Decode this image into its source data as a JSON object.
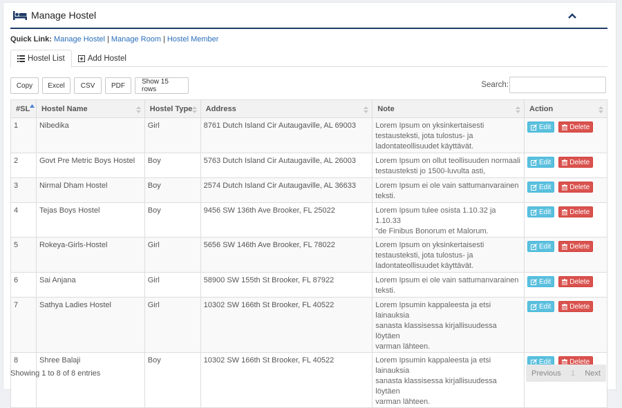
{
  "header": {
    "title": "Manage Hostel"
  },
  "quick_links": {
    "label": "Quick Link:",
    "items": [
      "Manage Hostel",
      "Manage Room",
      "Hostel Member"
    ]
  },
  "tabs": [
    {
      "label": "Hostel List",
      "icon": "list-icon",
      "active": true
    },
    {
      "label": "Add Hostel",
      "icon": "plus-square-icon",
      "active": false
    }
  ],
  "toolbar": {
    "buttons": [
      "Copy",
      "Excel",
      "CSV",
      "PDF",
      "Show 15 rows"
    ],
    "search_label": "Search:",
    "search_value": ""
  },
  "table": {
    "columns": [
      "#SL",
      "Hostel Name",
      "Hostel Type",
      "Address",
      "Note",
      "Action"
    ],
    "edit_label": "Edit",
    "delete_label": "Delete",
    "rows": [
      {
        "sl": "1",
        "name": "Nibedika",
        "type": "Girl",
        "address": "8761 Dutch Island Cir Autaugaville, AL 69003",
        "note": [
          "Lorem Ipsum on yksinkertaisesti",
          "testausteksti, jota tulostus- ja",
          "ladontateollisuudet käyttävät."
        ]
      },
      {
        "sl": "2",
        "name": "Govt Pre Metric Boys Hostel",
        "type": "Boy",
        "address": "5763 Dutch Island Cir Autaugaville, AL 26003",
        "note": [
          "Lorem Ipsum on ollut teollisuuden normaali",
          "testausteksti jo 1500-luvulta asti,"
        ]
      },
      {
        "sl": "3",
        "name": "Nirmal Dham Hostel",
        "type": "Boy",
        "address": "2574 Dutch Island Cir Autaugaville, AL 36633",
        "note": [
          "Lorem Ipsum ei ole vain sattumanvarainen",
          "teksti."
        ]
      },
      {
        "sl": "4",
        "name": "Tejas Boys Hostel",
        "type": "Boy",
        "address": "9456 SW 136th Ave Brooker, FL 25022",
        "note": [
          "Lorem Ipsum tulee osista 1.10.32 ja 1.10.33",
          "\"de Finibus Bonorum et Malorum."
        ]
      },
      {
        "sl": "5",
        "name": "Rokeya-Girls-Hostel",
        "type": "Girl",
        "address": "5656 SW 146th Ave Brooker, FL 78022",
        "note": [
          "Lorem Ipsum on yksinkertaisesti",
          "testausteksti, jota tulostus- ja",
          "ladontateollisuudet käyttävät."
        ]
      },
      {
        "sl": "6",
        "name": "Sai Anjana",
        "type": "Girl",
        "address": "58900 SW 155th St Brooker, FL 87922",
        "note": [
          "Lorem Ipsum ei ole vain sattumanvarainen",
          "teksti."
        ]
      },
      {
        "sl": "7",
        "name": "Sathya Ladies Hostel",
        "type": "Girl",
        "address": "10302 SW 166th St Brooker, FL 40522",
        "note": [
          "Lorem Ipsumin kappaleesta ja etsi lainauksia",
          "sanasta klassisessa kirjallisuudessa löytäen",
          "varman lähteen."
        ]
      },
      {
        "sl": "8",
        "name": "Shree Balaji",
        "type": "Boy",
        "address": "10302 SW 166th St Brooker, FL 40522",
        "note": [
          "Lorem Ipsumin kappaleesta ja etsi lainauksia",
          "sanasta klassisessa kirjallisuudessa löytäen",
          "varman lähteen."
        ]
      }
    ]
  },
  "footer": {
    "info": "Showing 1 to 8 of 8 entries",
    "previous": "Previous",
    "page": "1",
    "next": "Next"
  },
  "colors": {
    "accent": "#1f3a66",
    "edit": "#5bc0de",
    "delete": "#d9534f",
    "link": "#2a6ebb"
  }
}
